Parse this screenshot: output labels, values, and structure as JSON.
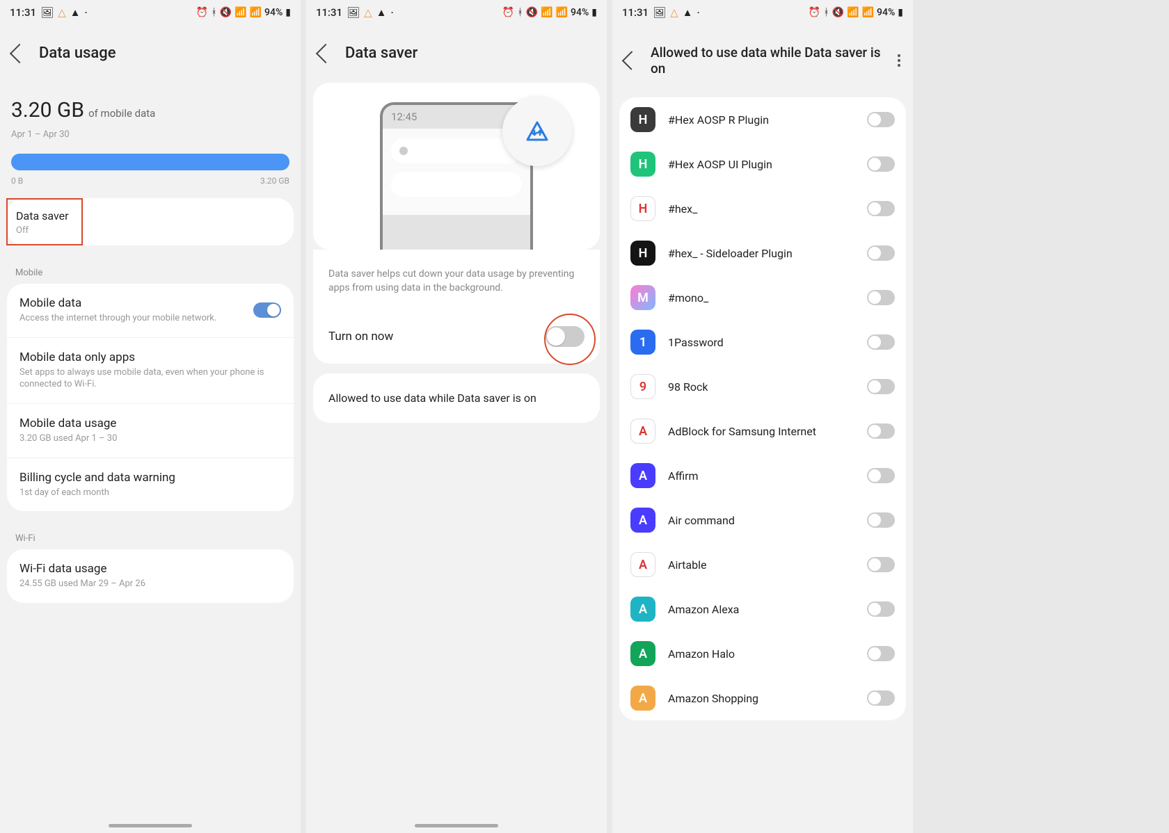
{
  "status": {
    "time": "11:31",
    "battery": "94%"
  },
  "screen1": {
    "title": "Data usage",
    "usage_value": "3.20 GB",
    "usage_label": "of mobile data",
    "period": "Apr 1 – Apr 30",
    "bar_min": "0 B",
    "bar_max": "3.20 GB",
    "data_saver_title": "Data saver",
    "data_saver_state": "Off",
    "section_mobile": "Mobile",
    "mobile_data_title": "Mobile data",
    "mobile_data_sub": "Access the internet through your mobile network.",
    "only_apps_title": "Mobile data only apps",
    "only_apps_sub": "Set apps to always use mobile data, even when your phone is connected to Wi-Fi.",
    "usage_title": "Mobile data usage",
    "usage_sub": "3.20 GB used Apr 1 – 30",
    "billing_title": "Billing cycle and data warning",
    "billing_sub": "1st day of each month",
    "section_wifi": "Wi-Fi",
    "wifi_usage_title": "Wi-Fi data usage",
    "wifi_usage_sub": "24.55 GB used Mar 29 – Apr 26"
  },
  "screen2": {
    "title": "Data saver",
    "mock_time": "12:45",
    "info": "Data saver helps cut down your data usage by preventing apps from using data in the background.",
    "turn_on": "Turn on now",
    "allowed": "Allowed to use data while Data saver is on"
  },
  "screen3": {
    "title": "Allowed to use data while Data saver is on",
    "apps": [
      {
        "name": "#Hex AOSP R Plugin",
        "bg": "#3a3a3a"
      },
      {
        "name": "#Hex AOSP UI Plugin",
        "bg": "#1fc47a"
      },
      {
        "name": "#hex_",
        "bg": "#ffffff"
      },
      {
        "name": "#hex_ - Sideloader Plugin",
        "bg": "#141414"
      },
      {
        "name": "#mono_",
        "bg": "linear-gradient(135deg,#ff7bd1,#7eb7ff)"
      },
      {
        "name": "1Password",
        "bg": "#2a6cf0"
      },
      {
        "name": "98 Rock",
        "bg": "#ffffff"
      },
      {
        "name": "AdBlock for Samsung Internet",
        "bg": "#ffffff"
      },
      {
        "name": "Affirm",
        "bg": "#4a3cff"
      },
      {
        "name": "Air command",
        "bg": "#4a3cff"
      },
      {
        "name": "Airtable",
        "bg": "#ffffff"
      },
      {
        "name": "Amazon Alexa",
        "bg": "#1fb4c4"
      },
      {
        "name": "Amazon Halo",
        "bg": "#12a55a"
      },
      {
        "name": "Amazon Shopping",
        "bg": "#f3a847"
      }
    ]
  }
}
